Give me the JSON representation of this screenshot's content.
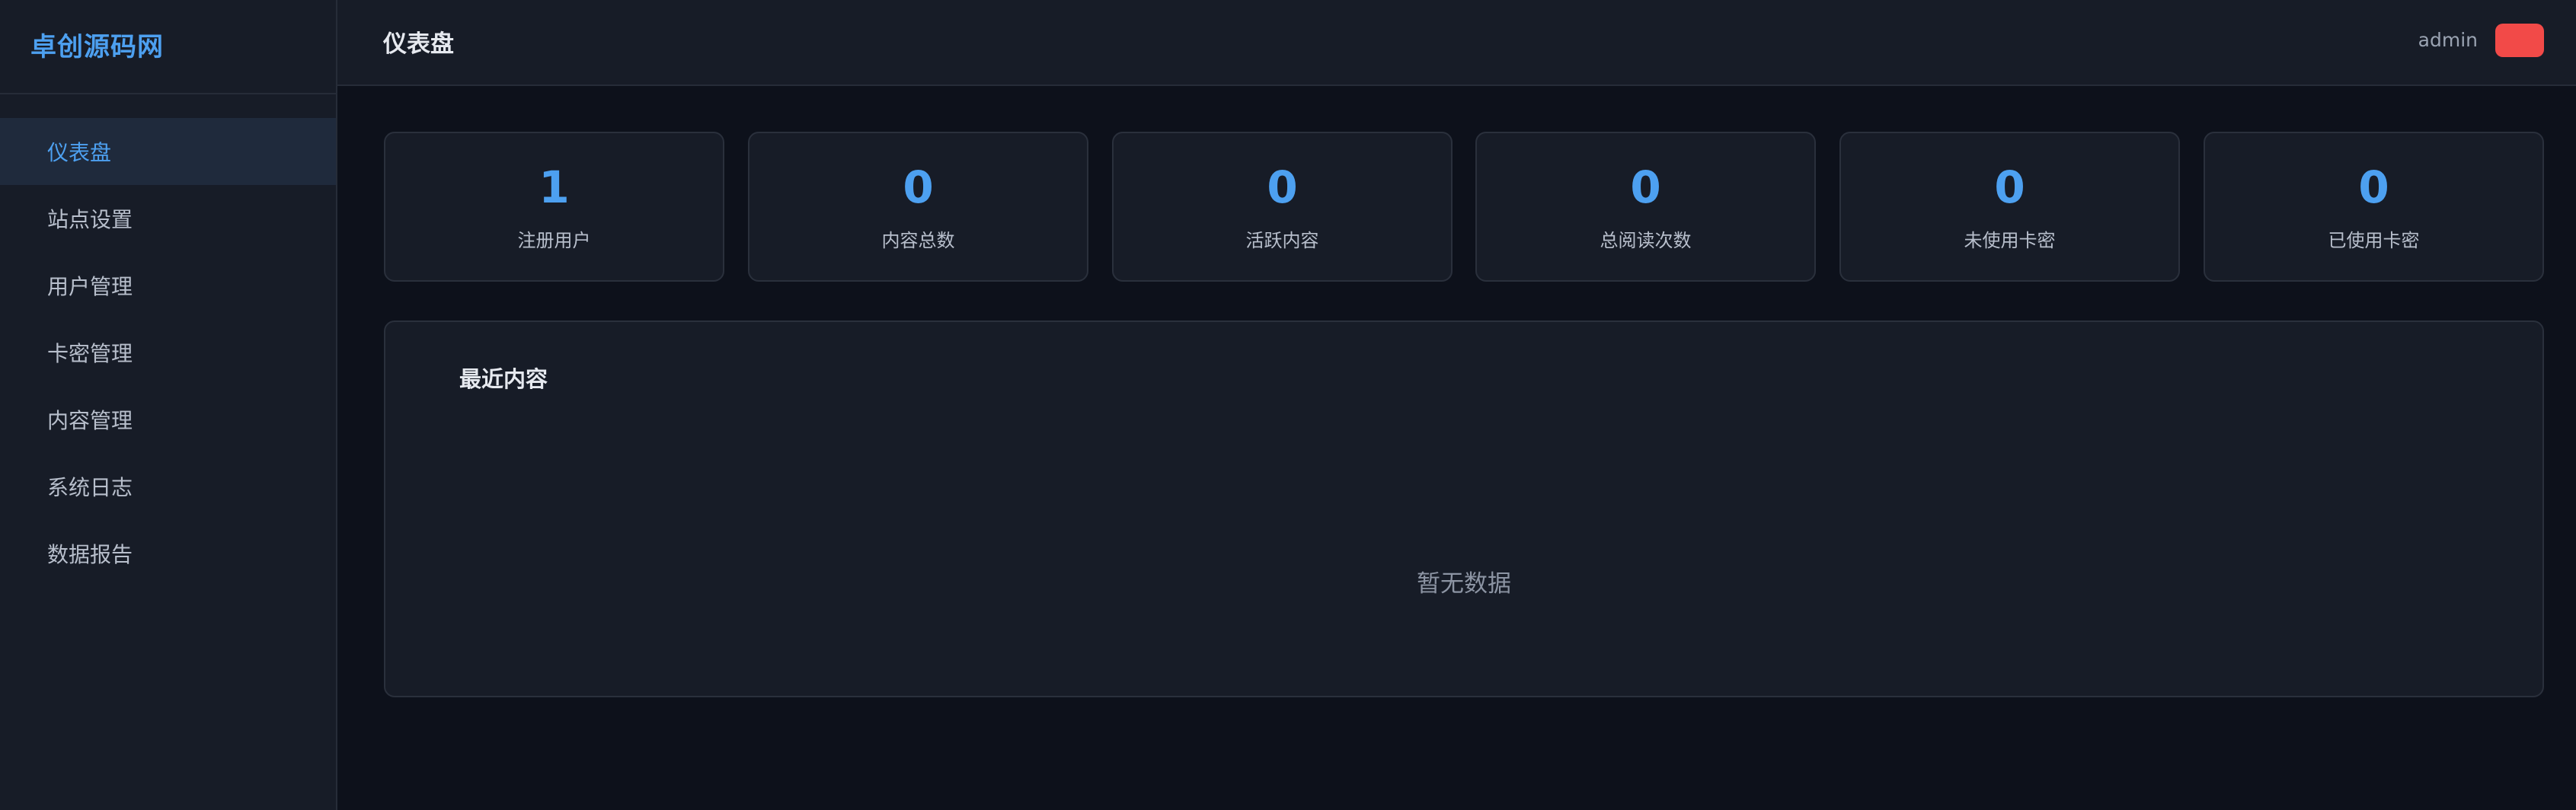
{
  "brand": {
    "title": "卓创源码网"
  },
  "sidebar": {
    "items": [
      {
        "label": "仪表盘",
        "active": true
      },
      {
        "label": "站点设置"
      },
      {
        "label": "用户管理"
      },
      {
        "label": "卡密管理"
      },
      {
        "label": "内容管理"
      },
      {
        "label": "系统日志"
      },
      {
        "label": "数据报告"
      }
    ]
  },
  "header": {
    "title": "仪表盘",
    "user": "admin"
  },
  "stats": [
    {
      "value": "1",
      "label": "注册用户"
    },
    {
      "value": "0",
      "label": "内容总数"
    },
    {
      "value": "0",
      "label": "活跃内容"
    },
    {
      "value": "0",
      "label": "总阅读次数"
    },
    {
      "value": "0",
      "label": "未使用卡密"
    },
    {
      "value": "0",
      "label": "已使用卡密"
    }
  ],
  "recent": {
    "title": "最近内容",
    "empty_text": "暂无数据"
  },
  "colors": {
    "accent": "#4da0f0",
    "danger": "#f24a48",
    "background": "#0d111b",
    "panel": "#171c27"
  }
}
